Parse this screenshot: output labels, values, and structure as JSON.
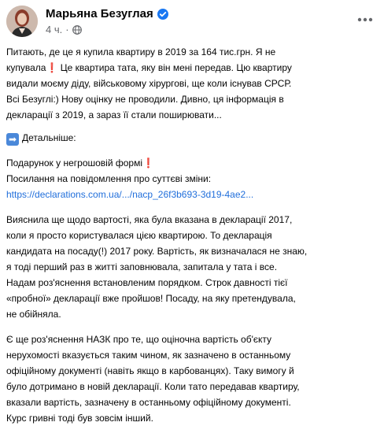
{
  "post": {
    "author": "Марьяна Безуглая",
    "time": "4 ч.",
    "separator": "·",
    "icons": {
      "verified": "verified-badge-icon",
      "audience": "globe-icon",
      "menu": "more-options-icon",
      "arrow": "right-arrow-emoji",
      "exclamation": "red-exclamation-emoji"
    },
    "colors": {
      "link": "#216fdb",
      "verified": "#1877f2",
      "muted": "#65676b",
      "exclamation": "#e0252b"
    },
    "p1": {
      "l1": "Питають, де це я купила квартиру в 2019 за 164 тис.грн. Я не",
      "l2a": "купувала",
      "l2_excl": "❗",
      "l2b": "Це квартира тата, яку він мені передав. Цю квартиру",
      "l3": "видали моєму діду, військовому хірургові, ще коли існував СРСР.",
      "l4": "Всі Безуглі:) Нову оцінку не проводили. Дивно, ця інформація в",
      "l5": "декларації з 2019, а зараз її стали поширювати..."
    },
    "details": "Детальніше:",
    "details_arrow": "➡",
    "p2": {
      "l1a": "Подарунок у негрошовій формі",
      "l1_excl": "❗",
      "l2": "Посилання на повідомлення про суттєві зміни:",
      "link": "https://declarations.com.ua/.../nacp_26f3b693-3d19-4ae2..."
    },
    "p3": {
      "l1": "Вияснила ще щодо вартості, яка була вказана в декларації 2017,",
      "l2": "коли я просто користувалася цією квартирою. То декларація",
      "l3": "кандидата на посаду(!) 2017 року. Вартість, як визначалася не знаю,",
      "l4": "я тоді перший раз в житті заповнювала, запитала у тата і все.",
      "l5": "Надам роз'яснення встановленим порядком. Строк давності тієї",
      "l6": "«пробної» декларації вже пройшов! Посаду, на яку претендувала,",
      "l7": "не обійняла."
    },
    "p4": {
      "l1": "Є ще роз'яснення НАЗК про те, що оціночна вартість об'єкту",
      "l2": "нерухомості вказується таким чином, як зазначено в останньому",
      "l3": "офіційному документі (навіть якщо в карбованцях). Таку вимогу й",
      "l4": "було дотримано в новій декларації. Коли тато передавав квартиру,",
      "l5": "вказали вартість, зазначену в останньому офіційному документі.",
      "l6": "Курс гривні тоді був зовсім інший."
    }
  }
}
